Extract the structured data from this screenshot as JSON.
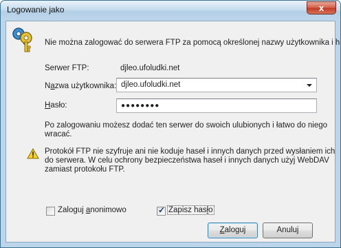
{
  "window": {
    "title": "Logowanie jako",
    "close_label": "x"
  },
  "message": "Nie można zalogować do serwera FTP za pomocą określonej nazwy użytkownika i hasła.",
  "fields": {
    "server_label": "Serwer FTP:",
    "server_value": "djleo.ufoludki.net",
    "user_label_pre": "N",
    "user_label_mnemonic": "a",
    "user_label_post": "zwa użytkownika:",
    "user_value": "djleo.ufoludki.net",
    "password_label_pre": "",
    "password_label_mnemonic": "H",
    "password_label_post": "asło:",
    "password_value": "●●●●●●●●"
  },
  "info_text_1": "Po zalogowaniu możesz dodać ten serwer do swoich ulubionych i łatwo do niego",
  "info_text_2": "wracać.",
  "warning": {
    "line1": "Protokół FTP nie szyfruje ani nie koduje haseł i innych danych przed wysłaniem ich",
    "line2": "do serwera. W celu ochrony bezpieczeństwa haseł i innych danych użyj WebDAV",
    "line3": "zamiast protokołu FTP."
  },
  "options": {
    "anonymous_pre": "Zaloguj ",
    "anonymous_mnemonic": "a",
    "anonymous_post": "nonimowo",
    "anonymous_checked": false,
    "save_pre": "Zapisz has",
    "save_mnemonic": "ł",
    "save_post": "o",
    "save_checked": true
  },
  "buttons": {
    "login_pre": "",
    "login_mnemonic": "Z",
    "login_post": "aloguj",
    "cancel": "Anuluj"
  }
}
